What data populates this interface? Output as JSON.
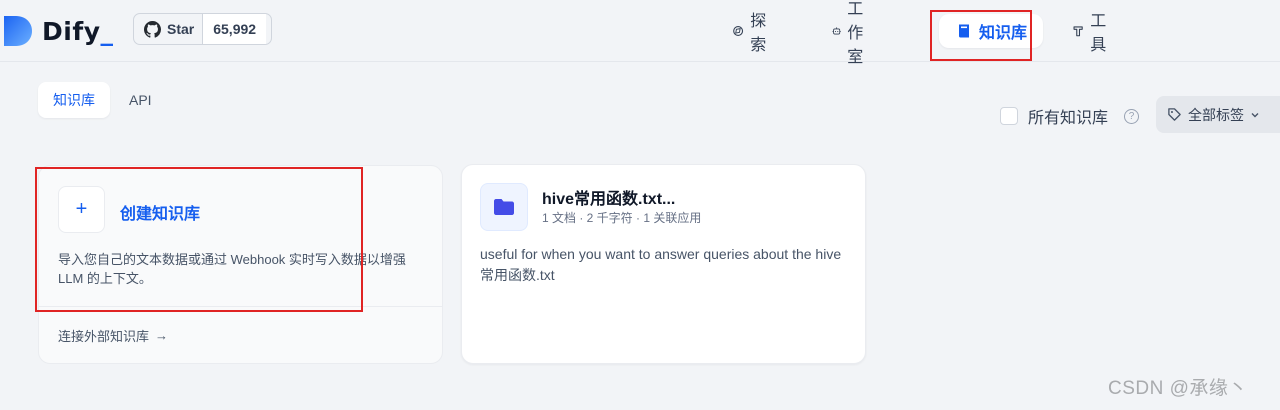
{
  "header": {
    "logo_text": "Dify",
    "logo_underscore": "_",
    "github": {
      "star_label": "Star",
      "count": "65,992",
      "icon": "github-icon"
    },
    "nav": [
      {
        "label": "探索",
        "icon": "compass-icon",
        "active": false
      },
      {
        "label": "工作室",
        "icon": "robot-icon",
        "active": false
      },
      {
        "label": "知识库",
        "icon": "book-icon",
        "active": true
      },
      {
        "label": "工具",
        "icon": "hammer-icon",
        "active": false
      }
    ]
  },
  "tabs": [
    {
      "label": "知识库",
      "active": true
    },
    {
      "label": "API",
      "active": false
    }
  ],
  "filters": {
    "all_knowledge_label": "所有知识库",
    "all_knowledge_checked": false,
    "tag_select_label": "全部标签"
  },
  "create_card": {
    "plus": "+",
    "title": "创建知识库",
    "description": "导入您自己的文本数据或通过 Webhook 实时写入数据以增强 LLM 的上下文。",
    "connect_label": "连接外部知识库",
    "connect_arrow": "→"
  },
  "datasets": [
    {
      "name": "hive常用函数.txt...",
      "meta": "1 文档 · 2 千字符 · 1 关联应用",
      "description": "useful for when you want to answer queries about the hive常用函数.txt"
    }
  ],
  "watermark": "CSDN @承缘丶",
  "colors": {
    "accent": "#155eef",
    "annotation_red": "#e02424",
    "background": "#f2f4f7",
    "folder_icon": "#444ce7"
  }
}
